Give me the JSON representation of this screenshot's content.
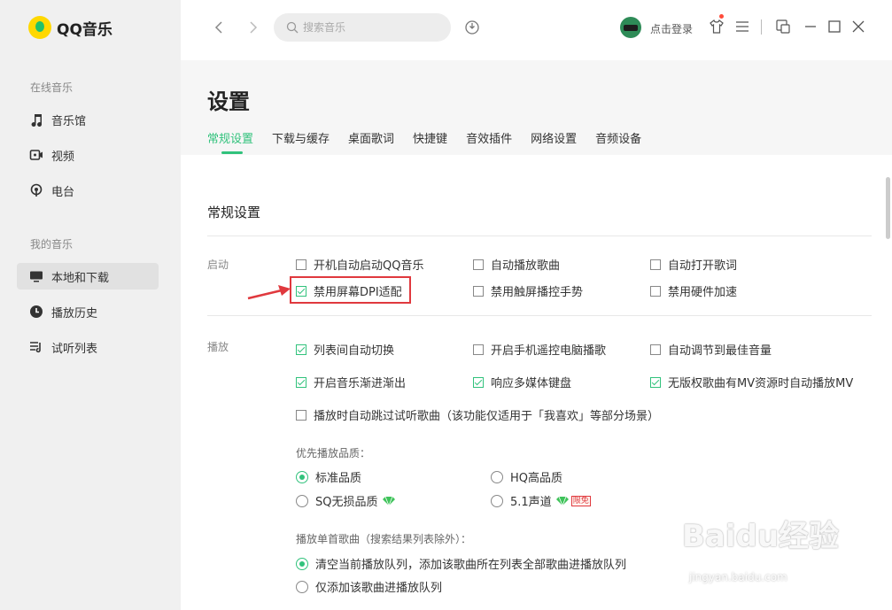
{
  "app": {
    "name": "QQ音乐"
  },
  "sidebar": {
    "sections": [
      {
        "title": "在线音乐",
        "items": [
          {
            "label": "音乐馆",
            "icon": "music-note-icon"
          },
          {
            "label": "视频",
            "icon": "video-icon"
          },
          {
            "label": "电台",
            "icon": "radio-icon"
          }
        ]
      },
      {
        "title": "我的音乐",
        "items": [
          {
            "label": "本地和下载",
            "icon": "computer-icon",
            "active": true
          },
          {
            "label": "播放历史",
            "icon": "clock-icon"
          },
          {
            "label": "试听列表",
            "icon": "playlist-icon"
          }
        ]
      }
    ]
  },
  "topbar": {
    "search_placeholder": "搜索音乐",
    "login_label": "点击登录"
  },
  "settings": {
    "title": "设置",
    "tabs": [
      "常规设置",
      "下载与缓存",
      "桌面歌词",
      "快捷键",
      "音效插件",
      "网络设置",
      "音频设备"
    ],
    "active_tab": "常规设置",
    "section_title": "常规设置",
    "startup": {
      "label": "启动",
      "options": [
        {
          "label": "开机自动启动QQ音乐",
          "checked": false
        },
        {
          "label": "自动播放歌曲",
          "checked": false
        },
        {
          "label": "自动打开歌词",
          "checked": false
        },
        {
          "label": "禁用屏幕DPI适配",
          "checked": true
        },
        {
          "label": "禁用触屏播控手势",
          "checked": false
        },
        {
          "label": "禁用硬件加速",
          "checked": false
        }
      ]
    },
    "playback": {
      "label": "播放",
      "options": [
        {
          "label": "列表间自动切换",
          "checked": true
        },
        {
          "label": "开启手机遥控电脑播歌",
          "checked": false
        },
        {
          "label": "自动调节到最佳音量",
          "checked": false
        },
        {
          "label": "开启音乐渐进渐出",
          "checked": true
        },
        {
          "label": "响应多媒体键盘",
          "checked": true
        },
        {
          "label": "无版权歌曲有MV资源时自动播放MV",
          "checked": true
        },
        {
          "label": "播放时自动跳过试听歌曲（该功能仅适用于「我喜欢」等部分场景）",
          "checked": false
        }
      ],
      "quality_label": "优先播放品质：",
      "quality_options": [
        {
          "label": "标准品质",
          "selected": true
        },
        {
          "label": "HQ高品质",
          "selected": false
        },
        {
          "label": "SQ无损品质",
          "selected": false,
          "vip": true
        },
        {
          "label": "5.1声道",
          "selected": false,
          "vip": true,
          "badge": "限免"
        }
      ],
      "single_label": "播放单首歌曲（搜索结果列表除外）：",
      "single_options": [
        {
          "label": "清空当前播放队列，添加该歌曲所在列表全部歌曲进播放队列",
          "selected": true
        },
        {
          "label": "仅添加该歌曲进播放队列",
          "selected": false
        }
      ]
    }
  },
  "watermark": {
    "text": "Baidu经验",
    "sub": "jingyan.baidu.com"
  },
  "colors": {
    "accent": "#31c27c",
    "highlight": "#e0393e",
    "sidebar_bg": "#f0f0f0"
  }
}
